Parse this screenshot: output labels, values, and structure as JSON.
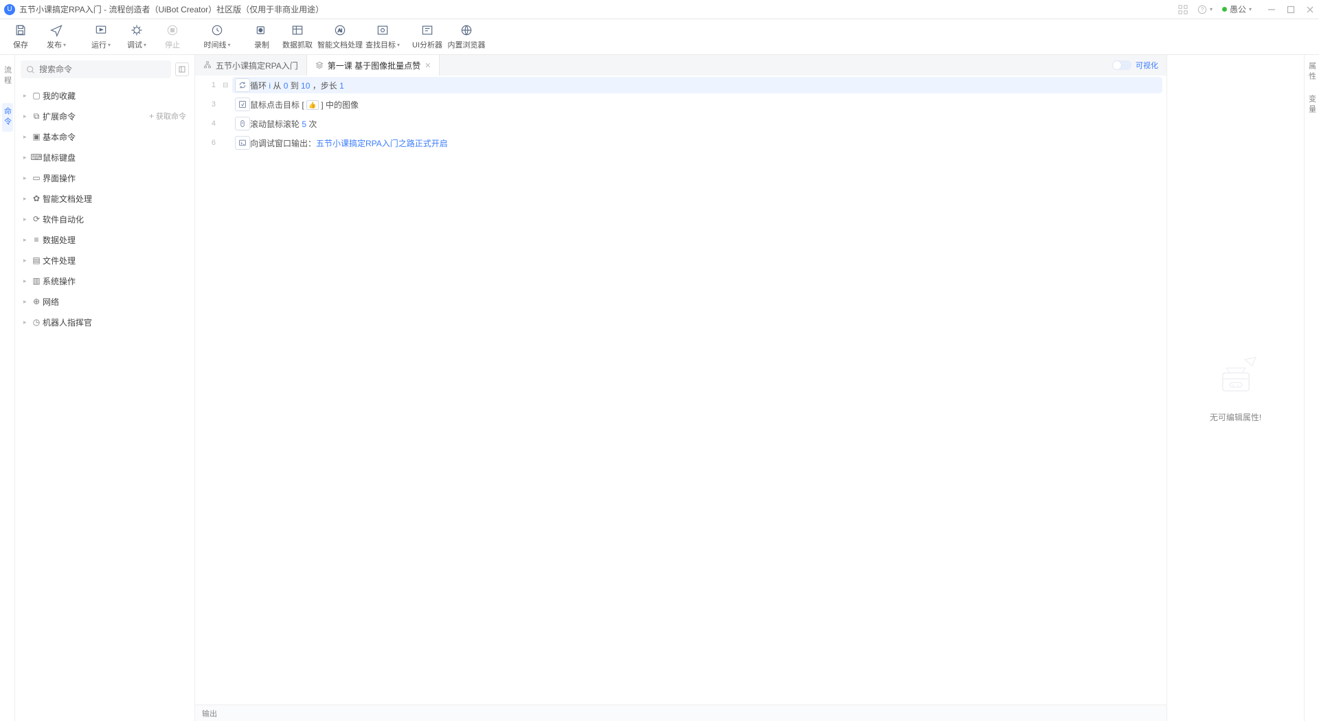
{
  "titlebar": {
    "title": "五节小课搞定RPA入门 - 流程创造者（UiBot Creator）社区版（仅用于非商业用途）",
    "user": "愚公"
  },
  "toolbar": {
    "save": "保存",
    "publish": "发布",
    "run": "运行",
    "debug": "调试",
    "stop": "停止",
    "timeline": "时间线",
    "record": "录制",
    "datagrab": "数据抓取",
    "docai": "智能文档处理",
    "findtarget": "查找目标",
    "uianalyzer": "UI分析器",
    "browser": "内置浏览器"
  },
  "leftstrip": {
    "flow": "流程",
    "cmd": "命令"
  },
  "sidebar": {
    "search_placeholder": "搜索命令",
    "get_cmd": "获取命令",
    "items": [
      {
        "label": "我的收藏"
      },
      {
        "label": "扩展命令"
      },
      {
        "label": "基本命令"
      },
      {
        "label": "鼠标键盘"
      },
      {
        "label": "界面操作"
      },
      {
        "label": "智能文档处理"
      },
      {
        "label": "软件自动化"
      },
      {
        "label": "数据处理"
      },
      {
        "label": "文件处理"
      },
      {
        "label": "系统操作"
      },
      {
        "label": "网络"
      },
      {
        "label": "机器人指挥官"
      }
    ]
  },
  "tabs": {
    "project": "五节小课搞定RPA入门",
    "file": "第一课 基于图像批量点赞",
    "viz": "可视化"
  },
  "steps": {
    "l1a": "循环 ",
    "l1var": "i",
    "l1b": " 从 ",
    "l1from": "0",
    "l1c": " 到 ",
    "l1to": "10",
    "l1d": " ，步长 ",
    "l1step": "1",
    "l3a": "鼠标点击目标 [ ",
    "l3b": " ] 中的图像",
    "l4a": "滚动鼠标滚轮 ",
    "l4n": "5",
    "l4b": " 次",
    "l6a": "向调试窗口输出：",
    "l6b": "五节小课搞定RPA入门之路正式开启"
  },
  "rightpanel": {
    "msg": "无可编辑属性!"
  },
  "rightstrip": {
    "a": "属性",
    "b": "变量"
  },
  "bottom": {
    "output": "输出"
  },
  "gutter": {
    "n1": "1",
    "n3": "3",
    "n4": "4",
    "n6": "6"
  }
}
